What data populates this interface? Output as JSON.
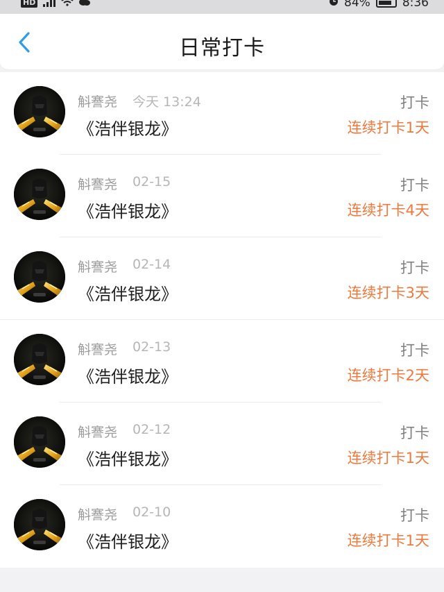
{
  "status_bar": {
    "hd": "HD",
    "battery": "84%",
    "time": "8:36"
  },
  "header": {
    "title": "日常打卡",
    "back_icon": "chevron-left-icon",
    "accent": "#2f9ce8"
  },
  "colors": {
    "streak": "#f0783c",
    "muted": "#9b9b9b"
  },
  "items": [
    {
      "user": "斛謇尧",
      "time": "今天 13:24",
      "book": "《浩伴银龙》",
      "action": "打卡",
      "streak": "连续打卡1天"
    },
    {
      "user": "斛謇尧",
      "time": "02-15",
      "book": "《浩伴银龙》",
      "action": "打卡",
      "streak": "连续打卡4天"
    },
    {
      "user": "斛謇尧",
      "time": "02-14",
      "book": "《浩伴银龙》",
      "action": "打卡",
      "streak": "连续打卡3天"
    },
    {
      "user": "斛謇尧",
      "time": "02-13",
      "book": "《浩伴银龙》",
      "action": "打卡",
      "streak": "连续打卡2天"
    },
    {
      "user": "斛謇尧",
      "time": "02-12",
      "book": "《浩伴银龙》",
      "action": "打卡",
      "streak": "连续打卡1天"
    },
    {
      "user": "斛謇尧",
      "time": "02-10",
      "book": "《浩伴银龙》",
      "action": "打卡",
      "streak": "连续打卡1天"
    }
  ]
}
